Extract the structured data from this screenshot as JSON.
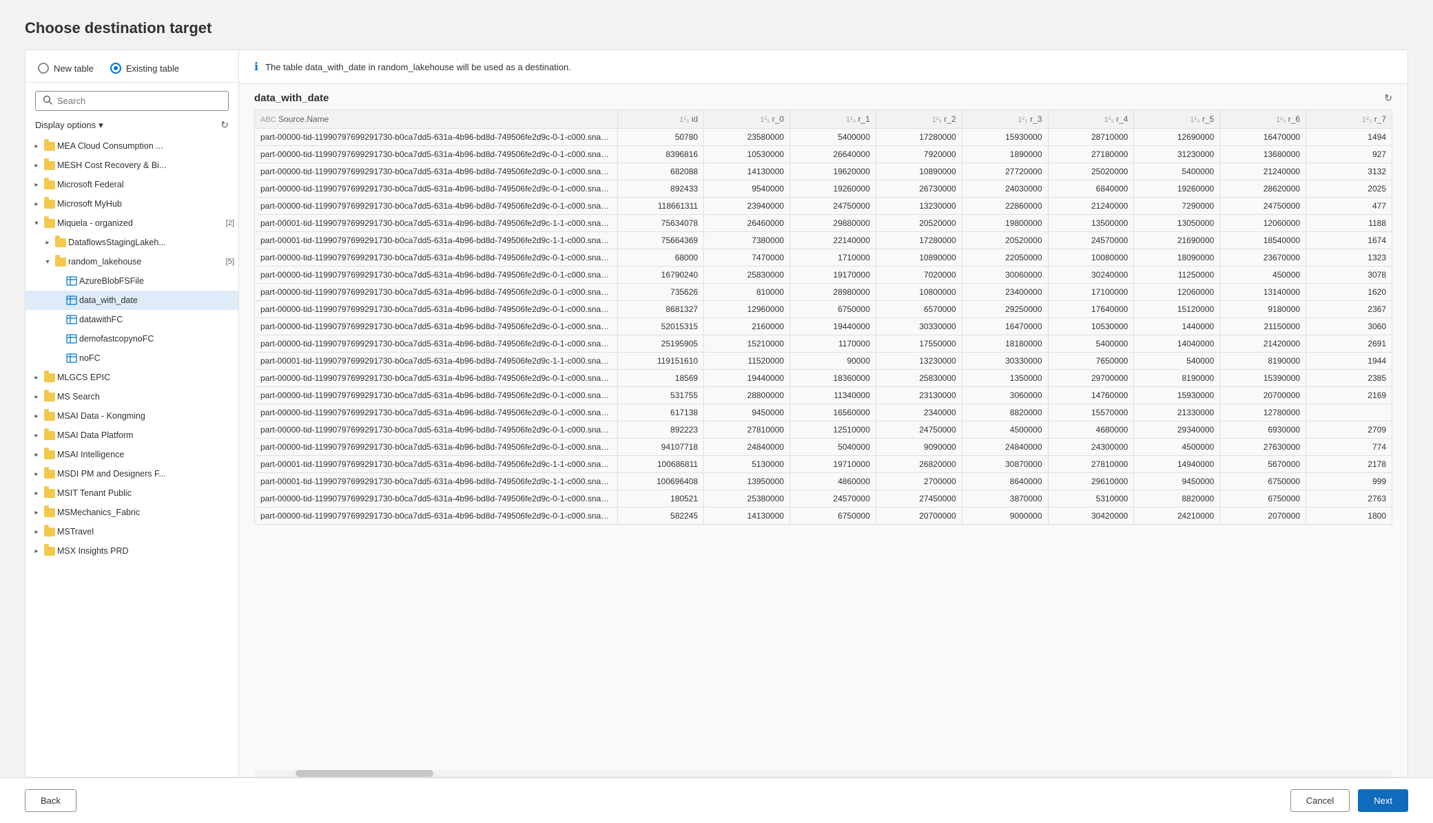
{
  "page": {
    "title": "Choose destination target"
  },
  "left": {
    "new_table_label": "New table",
    "existing_table_label": "Existing table",
    "search_placeholder": "Search",
    "display_options_label": "Display options",
    "tree": [
      {
        "id": "mea",
        "label": "MEA Cloud Consumption ...",
        "level": 1,
        "type": "folder",
        "state": "closed"
      },
      {
        "id": "mesh",
        "label": "MESH Cost Recovery & Bi...",
        "level": 1,
        "type": "folder",
        "state": "closed"
      },
      {
        "id": "msfederal",
        "label": "Microsoft Federal",
        "level": 1,
        "type": "folder",
        "state": "closed"
      },
      {
        "id": "msmyhub",
        "label": "Microsoft MyHub",
        "level": 1,
        "type": "folder",
        "state": "closed"
      },
      {
        "id": "miquela",
        "label": "Miquela - organized",
        "level": 1,
        "type": "folder",
        "state": "open",
        "badge": "[2]"
      },
      {
        "id": "dataflows",
        "label": "DataflowsStagingLakeh...",
        "level": 2,
        "type": "folder",
        "state": "closed"
      },
      {
        "id": "random",
        "label": "random_lakehouse",
        "level": 2,
        "type": "folder",
        "state": "open",
        "badge": "[5]"
      },
      {
        "id": "azureblob",
        "label": "AzureBlobFSFile",
        "level": 3,
        "type": "table",
        "state": "none"
      },
      {
        "id": "datawithdate",
        "label": "data_with_date",
        "level": 3,
        "type": "table",
        "state": "none",
        "selected": true
      },
      {
        "id": "datawithfc",
        "label": "datawithFC",
        "level": 3,
        "type": "table",
        "state": "none"
      },
      {
        "id": "demofastcopynofc",
        "label": "demofastcopynoFC",
        "level": 3,
        "type": "table",
        "state": "none"
      },
      {
        "id": "nofc",
        "label": "noFC",
        "level": 3,
        "type": "table",
        "state": "none"
      },
      {
        "id": "mlgcs",
        "label": "MLGCS EPIC",
        "level": 1,
        "type": "folder",
        "state": "closed"
      },
      {
        "id": "mssearch",
        "label": "MS Search",
        "level": 1,
        "type": "folder",
        "state": "closed"
      },
      {
        "id": "msaidatakong",
        "label": "MSAI Data - Kongming",
        "level": 1,
        "type": "folder",
        "state": "closed"
      },
      {
        "id": "msaidataplatform",
        "label": "MSAI Data Platform",
        "level": 1,
        "type": "folder",
        "state": "closed"
      },
      {
        "id": "msaiintelligence",
        "label": "MSAI Intelligence",
        "level": 1,
        "type": "folder",
        "state": "closed"
      },
      {
        "id": "msdipmdfs",
        "label": "MSDI PM and Designers F...",
        "level": 1,
        "type": "folder",
        "state": "closed"
      },
      {
        "id": "msittenantpublic",
        "label": "MSIT Tenant Public",
        "level": 1,
        "type": "folder",
        "state": "closed"
      },
      {
        "id": "msmechanicsfabric",
        "label": "MSMechanics_Fabric",
        "level": 1,
        "type": "folder",
        "state": "closed"
      },
      {
        "id": "mstravel",
        "label": "MSTravel",
        "level": 1,
        "type": "folder",
        "state": "closed"
      },
      {
        "id": "msxinsightsprd",
        "label": "MSX Insights PRD",
        "level": 1,
        "type": "folder",
        "state": "closed"
      }
    ]
  },
  "right": {
    "info_text": "The table data_with_date in random_lakehouse will be used as a destination.",
    "table_name": "data_with_date",
    "columns": [
      {
        "label": "Source.Name",
        "type": "ABC",
        "width": "380"
      },
      {
        "label": "id",
        "type": "1²₃",
        "width": "90"
      },
      {
        "label": "r_0",
        "type": "1²₃",
        "width": "90"
      },
      {
        "label": "r_1",
        "type": "1²₃",
        "width": "90"
      },
      {
        "label": "r_2",
        "type": "1²₃",
        "width": "90"
      },
      {
        "label": "r_3",
        "type": "1²₃",
        "width": "90"
      },
      {
        "label": "r_4",
        "type": "1²₃",
        "width": "90"
      },
      {
        "label": "r_5",
        "type": "1²₃",
        "width": "90"
      },
      {
        "label": "r_6",
        "type": "1²₃",
        "width": "90"
      },
      {
        "label": "r_7",
        "type": "1²₃",
        "width": "90"
      }
    ],
    "rows": [
      [
        "part-00000-tid-11990797699291730-b0ca7dd5-631a-4b96-bd8d-749506fe2d9c-0-1-c000.snap...",
        "50780",
        "23580000",
        "5400000",
        "17280000",
        "15930000",
        "28710000",
        "12690000",
        "16470000",
        "1494"
      ],
      [
        "part-00000-tid-11990797699291730-b0ca7dd5-631a-4b96-bd8d-749506fe2d9c-0-1-c000.snap...",
        "8396816",
        "10530000",
        "26640000",
        "7920000",
        "1890000",
        "27180000",
        "31230000",
        "13680000",
        "927"
      ],
      [
        "part-00000-tid-11990797699291730-b0ca7dd5-631a-4b96-bd8d-749506fe2d9c-0-1-c000.snap...",
        "682088",
        "14130000",
        "19620000",
        "10890000",
        "27720000",
        "25020000",
        "5400000",
        "21240000",
        "3132"
      ],
      [
        "part-00000-tid-11990797699291730-b0ca7dd5-631a-4b96-bd8d-749506fe2d9c-0-1-c000.snap...",
        "892433",
        "9540000",
        "19260000",
        "26730000",
        "24030000",
        "6840000",
        "19260000",
        "28620000",
        "2025"
      ],
      [
        "part-00000-tid-11990797699291730-b0ca7dd5-631a-4b96-bd8d-749506fe2d9c-0-1-c000.snap...",
        "118661311",
        "23940000",
        "24750000",
        "13230000",
        "22860000",
        "21240000",
        "7290000",
        "24750000",
        "477"
      ],
      [
        "part-00001-tid-11990797699291730-b0ca7dd5-631a-4b96-bd8d-749506fe2d9c-1-1-c000.snap...",
        "75634078",
        "26460000",
        "29880000",
        "20520000",
        "19800000",
        "13500000",
        "13050000",
        "12060000",
        "1188"
      ],
      [
        "part-00001-tid-11990797699291730-b0ca7dd5-631a-4b96-bd8d-749506fe2d9c-1-1-c000.snap...",
        "75664369",
        "7380000",
        "22140000",
        "17280000",
        "20520000",
        "24570000",
        "21690000",
        "18540000",
        "1674"
      ],
      [
        "part-00000-tid-11990797699291730-b0ca7dd5-631a-4b96-bd8d-749506fe2d9c-0-1-c000.snap...",
        "68000",
        "7470000",
        "1710000",
        "10890000",
        "22050000",
        "10080000",
        "18090000",
        "23670000",
        "1323"
      ],
      [
        "part-00000-tid-11990797699291730-b0ca7dd5-631a-4b96-bd8d-749506fe2d9c-0-1-c000.snap...",
        "16790240",
        "25830000",
        "19170000",
        "7020000",
        "30060000",
        "30240000",
        "11250000",
        "450000",
        "3078"
      ],
      [
        "part-00000-tid-11990797699291730-b0ca7dd5-631a-4b96-bd8d-749506fe2d9c-0-1-c000.snap...",
        "735626",
        "810000",
        "28980000",
        "10800000",
        "23400000",
        "17100000",
        "12060000",
        "13140000",
        "1620"
      ],
      [
        "part-00000-tid-11990797699291730-b0ca7dd5-631a-4b96-bd8d-749506fe2d9c-0-1-c000.snap...",
        "8681327",
        "12960000",
        "6750000",
        "6570000",
        "29250000",
        "17640000",
        "15120000",
        "9180000",
        "2367"
      ],
      [
        "part-00000-tid-11990797699291730-b0ca7dd5-631a-4b96-bd8d-749506fe2d9c-0-1-c000.snap...",
        "52015315",
        "2160000",
        "19440000",
        "30330000",
        "16470000",
        "10530000",
        "1440000",
        "21150000",
        "3060"
      ],
      [
        "part-00000-tid-11990797699291730-b0ca7dd5-631a-4b96-bd8d-749506fe2d9c-0-1-c000.snap...",
        "25195905",
        "15210000",
        "1170000",
        "17550000",
        "18180000",
        "5400000",
        "14040000",
        "21420000",
        "2691"
      ],
      [
        "part-00001-tid-11990797699291730-b0ca7dd5-631a-4b96-bd8d-749506fe2d9c-1-1-c000.snap...",
        "119151610",
        "11520000",
        "90000",
        "13230000",
        "30330000",
        "7650000",
        "540000",
        "8190000",
        "1944"
      ],
      [
        "part-00000-tid-11990797699291730-b0ca7dd5-631a-4b96-bd8d-749506fe2d9c-0-1-c000.snap...",
        "18569",
        "19440000",
        "18360000",
        "25830000",
        "1350000",
        "29700000",
        "8190000",
        "15390000",
        "2385"
      ],
      [
        "part-00000-tid-11990797699291730-b0ca7dd5-631a-4b96-bd8d-749506fe2d9c-0-1-c000.snap...",
        "531755",
        "28800000",
        "11340000",
        "23130000",
        "3060000",
        "14760000",
        "15930000",
        "20700000",
        "2169"
      ],
      [
        "part-00000-tid-11990797699291730-b0ca7dd5-631a-4b96-bd8d-749506fe2d9c-0-1-c000.snap...",
        "617138",
        "9450000",
        "16560000",
        "2340000",
        "8820000",
        "15570000",
        "21330000",
        "12780000",
        ""
      ],
      [
        "part-00000-tid-11990797699291730-b0ca7dd5-631a-4b96-bd8d-749506fe2d9c-0-1-c000.snap...",
        "892223",
        "27810000",
        "12510000",
        "24750000",
        "4500000",
        "4680000",
        "29340000",
        "6930000",
        "2709"
      ],
      [
        "part-00000-tid-11990797699291730-b0ca7dd5-631a-4b96-bd8d-749506fe2d9c-0-1-c000.snap...",
        "94107718",
        "24840000",
        "5040000",
        "9090000",
        "24840000",
        "24300000",
        "4500000",
        "27630000",
        "774"
      ],
      [
        "part-00001-tid-11990797699291730-b0ca7dd5-631a-4b96-bd8d-749506fe2d9c-1-1-c000.snap...",
        "100686811",
        "5130000",
        "19710000",
        "26820000",
        "30870000",
        "27810000",
        "14940000",
        "5670000",
        "2178"
      ],
      [
        "part-00001-tid-11990797699291730-b0ca7dd5-631a-4b96-bd8d-749506fe2d9c-1-1-c000.snap...",
        "100696408",
        "13950000",
        "4860000",
        "2700000",
        "8640000",
        "29610000",
        "9450000",
        "6750000",
        "999"
      ],
      [
        "part-00000-tid-11990797699291730-b0ca7dd5-631a-4b96-bd8d-749506fe2d9c-0-1-c000.snap...",
        "180521",
        "25380000",
        "24570000",
        "27450000",
        "3870000",
        "5310000",
        "8820000",
        "6750000",
        "2763"
      ],
      [
        "part-00000-tid-11990797699291730-b0ca7dd5-631a-4b96-bd8d-749506fe2d9c-0-1-c000.snap...",
        "582245",
        "14130000",
        "6750000",
        "20700000",
        "9000000",
        "30420000",
        "24210000",
        "2070000",
        "1800"
      ]
    ]
  },
  "footer": {
    "back_label": "Back",
    "cancel_label": "Cancel",
    "next_label": "Next"
  }
}
